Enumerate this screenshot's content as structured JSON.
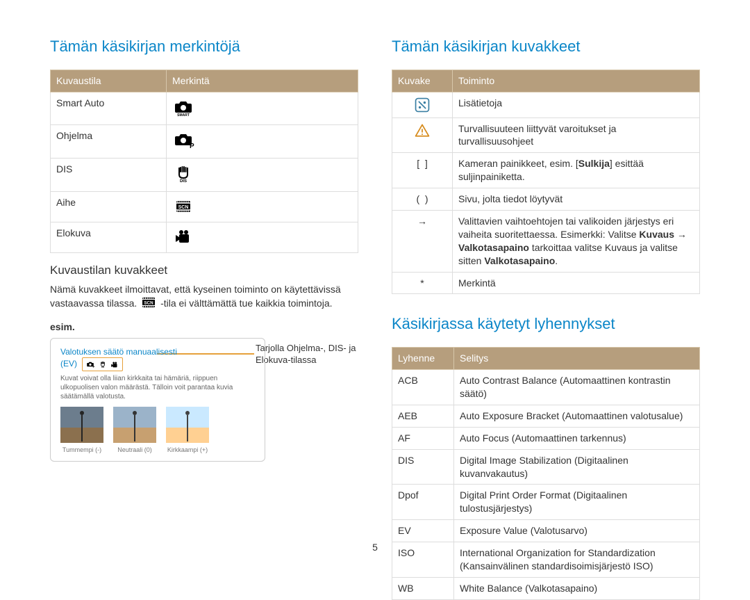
{
  "page_number": "5",
  "left": {
    "heading_notation": "Tämän käsikirjan merkintöjä",
    "shoot_table": {
      "head_mode": "Kuvaustila",
      "head_mark": "Merkintä",
      "rows": [
        {
          "mode": "Smart Auto"
        },
        {
          "mode": "Ohjelma"
        },
        {
          "mode": "DIS"
        },
        {
          "mode": "Aihe"
        },
        {
          "mode": "Elokuva"
        }
      ]
    },
    "sub_heading": "Kuvaustilan kuvakkeet",
    "sub_para_a": "Nämä kuvakkeet ilmoittavat, että kyseinen toiminto on käytettävissä vastaavassa tilassa. ",
    "sub_para_b": "-tila ei välttämättä tue kaikkia toimintoja.",
    "example_label": "esim.",
    "example": {
      "title_line1": "Valotuksen säätö manuaalisesti",
      "title_line2_pre": "(EV)",
      "body": "Kuvat voivat olla liian kirkkaita tai hämäriä, riippuen ulkopuolisen valon määrästä. Tälloin voit parantaa kuvia säätämällä valotusta.",
      "thumbs": [
        "Tummempi (-)",
        "Neutraali (0)",
        "Kirkkaampi (+)"
      ],
      "callout": "Tarjolla Ohjelma-, DIS- ja Elokuva-tilassa"
    }
  },
  "right": {
    "heading_icons": "Tämän käsikirjan kuvakkeet",
    "icon_table": {
      "head_icon": "Kuvake",
      "head_func": "Toiminto",
      "rows": [
        {
          "glyph": "info",
          "func_plain": "Lisätietoja"
        },
        {
          "glyph": "warn",
          "func_plain": "Turvallisuuteen liittyvät varoitukset ja turvallisuusohjeet"
        },
        {
          "glyph": "brackets",
          "func_pre": "Kameran painikkeet, esim. [",
          "func_bold": "Sulkija",
          "func_post": "] esittää suljinpainiketta."
        },
        {
          "glyph": "parens",
          "func_plain": "Sivu, jolta tiedot löytyvät"
        },
        {
          "glyph": "arrow",
          "func_pre": "Valittavien vaihtoehtojen tai valikoiden järjestys eri vaiheita suoritettaessa. Esimerkki: Valitse ",
          "func_bold": "Kuvaus",
          "func_mid": " → ",
          "func_bold2": "Valkotasapaino",
          "func_post2": " tarkoittaa valitse Kuvaus ja valitse sitten ",
          "func_bold3": "Valkotasapaino",
          "func_post3": "."
        },
        {
          "glyph": "star",
          "func_plain": "Merkintä"
        }
      ]
    },
    "heading_abbr": "Käsikirjassa käytetyt lyhennykset",
    "abbr_table": {
      "head_abbr": "Lyhenne",
      "head_expl": "Selitys",
      "rows": [
        {
          "a": "ACB",
          "e": "Auto Contrast Balance (Automaattinen kontrastin säätö)"
        },
        {
          "a": "AEB",
          "e": "Auto Exposure Bracket (Automaattinen valotusalue)"
        },
        {
          "a": "AF",
          "e": "Auto Focus (Automaattinen tarkennus)"
        },
        {
          "a": "DIS",
          "e": "Digital Image Stabilization (Digitaalinen kuvanvakautus)"
        },
        {
          "a": "Dpof",
          "e": "Digital Print Order Format (Digitaalinen tulostusjärjestys)"
        },
        {
          "a": "EV",
          "e": "Exposure Value (Valotusarvo)"
        },
        {
          "a": "ISO",
          "e": "International Organization for Standardization (Kansainvälinen standardisoimisjärjestö ISO)"
        },
        {
          "a": "WB",
          "e": "White Balance (Valkotasapaino)"
        }
      ]
    }
  }
}
